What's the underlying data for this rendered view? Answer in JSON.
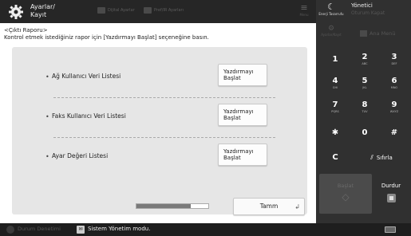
{
  "header": {
    "title_line1": "Ayarlar/",
    "title_line2": "Kayıt",
    "buttons": [
      "Dijital Ayarlar",
      "Pref/IR Ayarları"
    ],
    "menu_label": "Menu"
  },
  "page": {
    "title": "<Çıktı Raporu>",
    "instruction": "Kontrol etmek istediğiniz rapor için [Yazdırmayı Başlat] seçeneğine basın."
  },
  "reports": [
    {
      "label": "Ağ Kullanıcı Veri Listesi",
      "button_line1": "Yazdırmayı",
      "button_line2": "Başlat"
    },
    {
      "label": "Faks Kullanıcı Veri Listesi",
      "button_line1": "Yazdırmayı",
      "button_line2": "Başlat"
    },
    {
      "label": "Ayar Değeri Listesi",
      "button_line1": "Yazdırmayı",
      "button_line2": "Başlat"
    }
  ],
  "bullet": "•",
  "progress_fraction": 0.75,
  "ok_button": "Tamm",
  "footer": {
    "status_label": "Durum Denetimi",
    "message": "Sistem Yönetim modu."
  },
  "side": {
    "energy_label": "Enerji Tasarrufu",
    "admin_line1": "Yönetici",
    "logout_label": "Oturum Kapat",
    "settings_label": "Ayarlar/Kayıt",
    "home_label": "Ana Menü",
    "keys": [
      {
        "digit": "1",
        "sub": ""
      },
      {
        "digit": "2",
        "sub": "ABC"
      },
      {
        "digit": "3",
        "sub": "DEF"
      },
      {
        "digit": "4",
        "sub": "GHI"
      },
      {
        "digit": "5",
        "sub": "JKL"
      },
      {
        "digit": "6",
        "sub": "MNO"
      },
      {
        "digit": "7",
        "sub": "PQRS"
      },
      {
        "digit": "8",
        "sub": "TUV"
      },
      {
        "digit": "9",
        "sub": "WXYZ"
      },
      {
        "digit": "✱",
        "sub": ""
      },
      {
        "digit": "0",
        "sub": ""
      },
      {
        "digit": "#",
        "sub": ""
      }
    ],
    "clear_label": "C",
    "reset_label": "Sıfırla",
    "start_label": "Başlat",
    "stop_label": "Durdur"
  }
}
